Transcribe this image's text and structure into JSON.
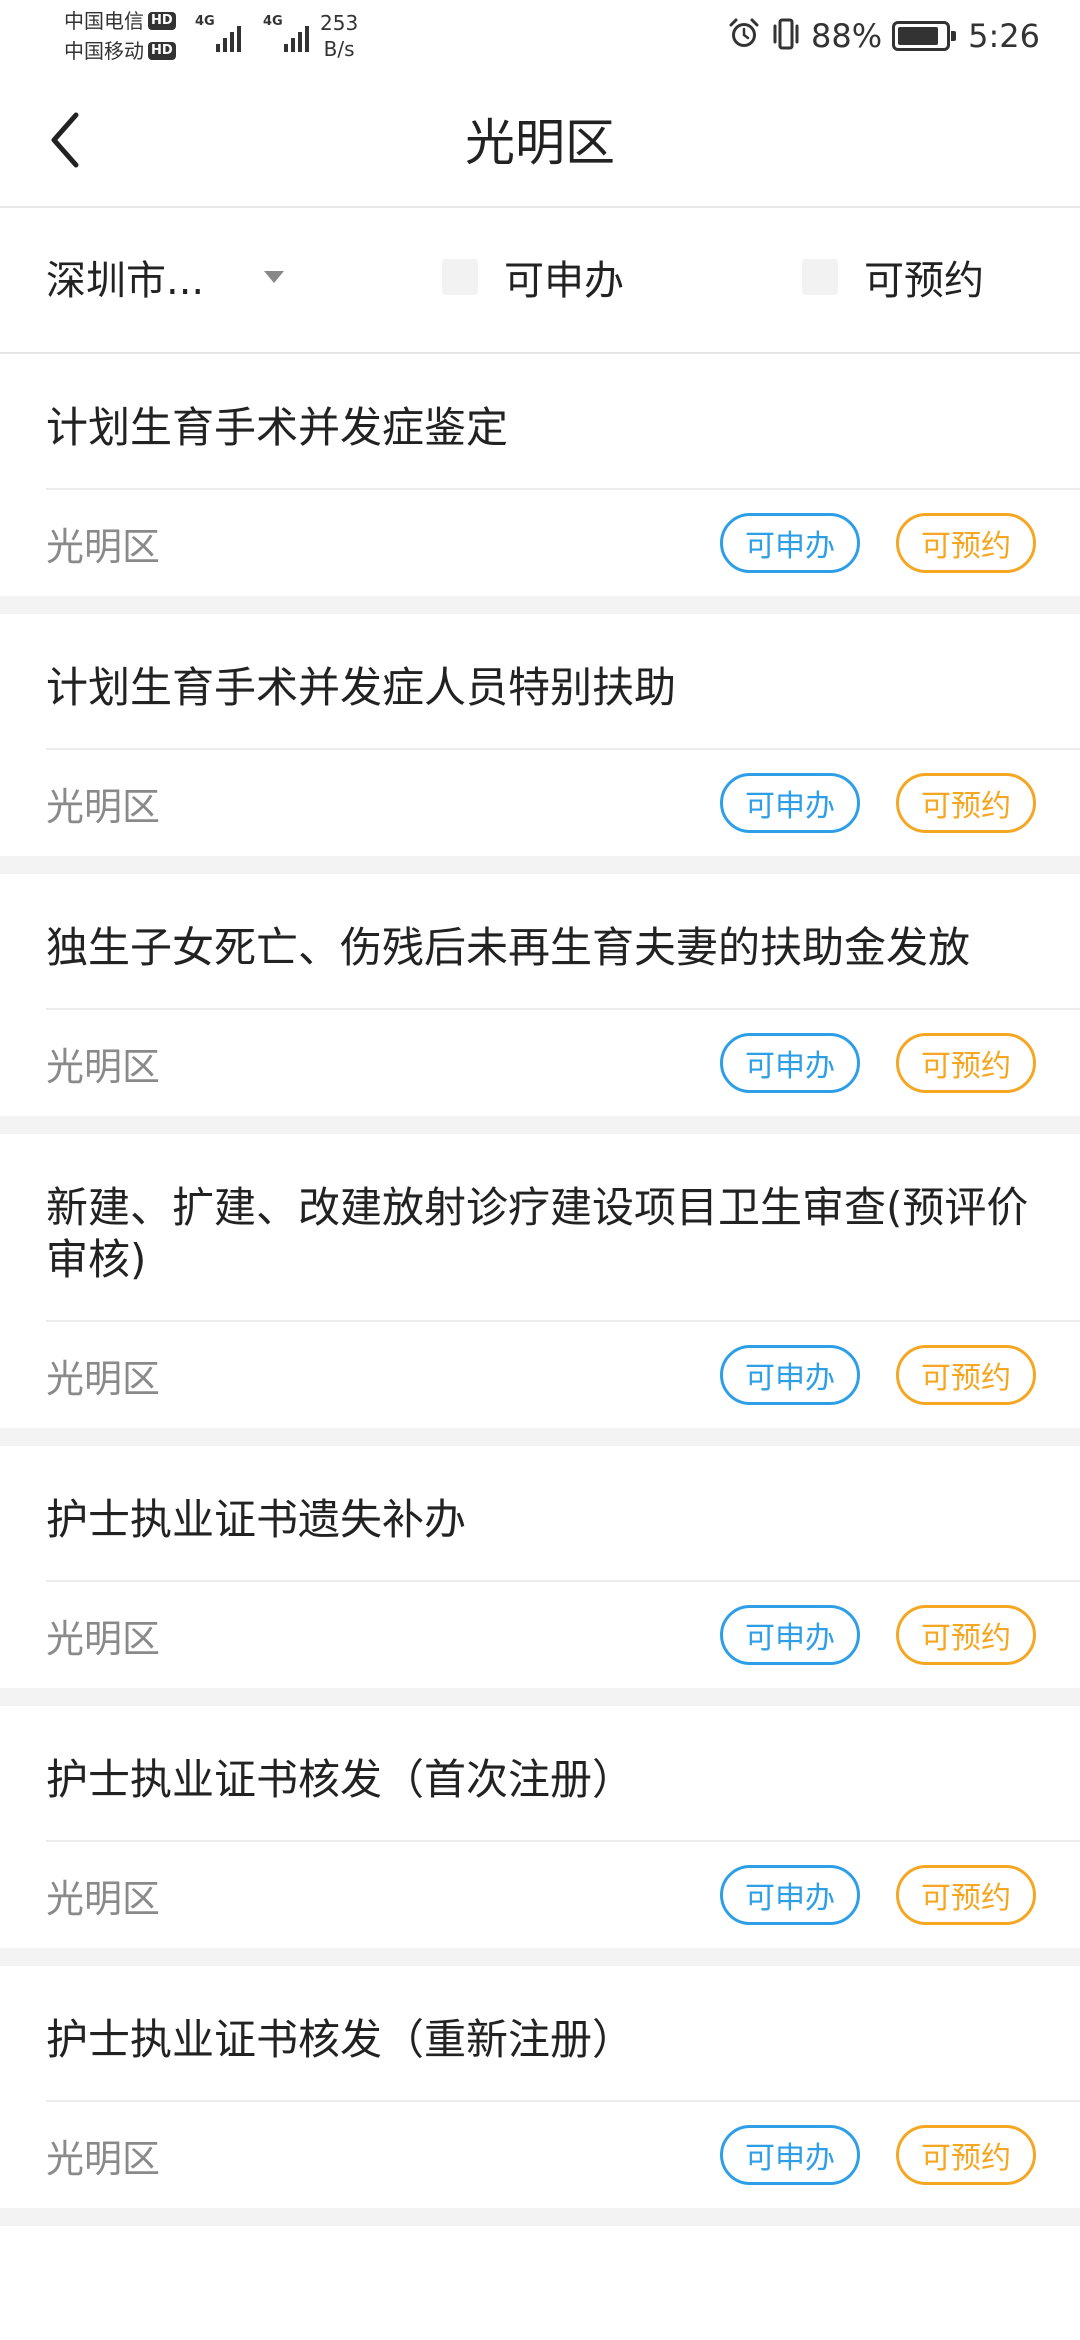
{
  "status_bar": {
    "carrier1": "中国电信",
    "carrier2": "中国移动",
    "hd": "HD",
    "net_type_1": "4G",
    "net_type_2": "4G",
    "speed_value": "253",
    "speed_unit": "B/s",
    "battery_percent": "88%",
    "battery_level": 0.88,
    "time": "5:26",
    "icons": [
      "alarm-icon",
      "vibrate-icon",
      "battery-icon"
    ]
  },
  "nav": {
    "title": "光明区",
    "back_icon": "chevron-left-icon"
  },
  "filters": {
    "city": "深圳市...",
    "apply_label": "可申办",
    "book_label": "可预约"
  },
  "tags": {
    "apply": "可申办",
    "book": "可预约"
  },
  "services": [
    {
      "title": "计划生育手术并发症鉴定",
      "district": "光明区"
    },
    {
      "title": "计划生育手术并发症人员特别扶助",
      "district": "光明区"
    },
    {
      "title": "独生子女死亡、伤残后未再生育夫妻的扶助金发放",
      "district": "光明区"
    },
    {
      "title": "新建、扩建、改建放射诊疗建设项目卫生审查(预评价审核)",
      "district": "光明区"
    },
    {
      "title": "护士执业证书遗失补办",
      "district": "光明区"
    },
    {
      "title": "护士执业证书核发（首次注册）",
      "district": "光明区"
    },
    {
      "title": "护士执业证书核发（重新注册）",
      "district": "光明区"
    }
  ],
  "colors": {
    "apply": "#2e9fe6",
    "book": "#f5a623",
    "divider": "#ececec",
    "gap": "#f3f3f3"
  }
}
